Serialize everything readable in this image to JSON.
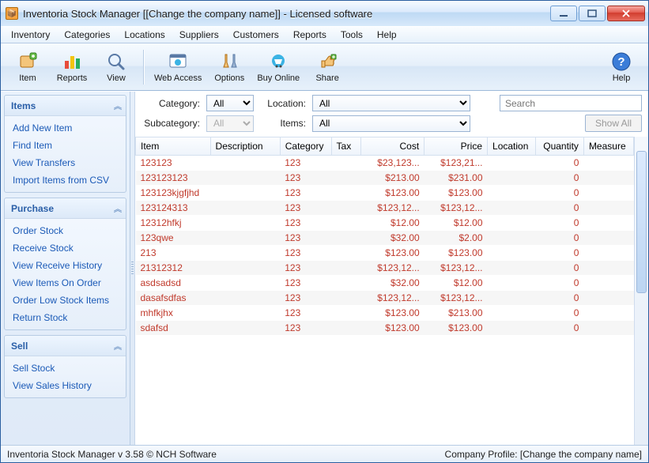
{
  "window": {
    "title": "Inventoria Stock Manager [[Change the company name]] - Licensed software"
  },
  "menu": [
    "Inventory",
    "Categories",
    "Locations",
    "Suppliers",
    "Customers",
    "Reports",
    "Tools",
    "Help"
  ],
  "toolbar": {
    "item": "Item",
    "reports": "Reports",
    "view": "View",
    "web_access": "Web Access",
    "options": "Options",
    "buy_online": "Buy Online",
    "share": "Share",
    "help": "Help"
  },
  "sidebar": {
    "groups": [
      {
        "title": "Items",
        "links": [
          "Add New Item",
          "Find Item",
          "View Transfers",
          "Import Items from CSV"
        ]
      },
      {
        "title": "Purchase",
        "links": [
          "Order Stock",
          "Receive Stock",
          "View Receive History",
          "View Items On Order",
          "Order Low Stock Items",
          "Return Stock"
        ]
      },
      {
        "title": "Sell",
        "links": [
          "Sell Stock",
          "View Sales History"
        ]
      }
    ]
  },
  "filters": {
    "category_label": "Category:",
    "category_value": "All",
    "location_label": "Location:",
    "location_value": "All",
    "subcategory_label": "Subcategory:",
    "subcategory_value": "All",
    "items_label": "Items:",
    "items_value": "All",
    "search_placeholder": "Search",
    "show_all": "Show All"
  },
  "columns": [
    "Item",
    "Description",
    "Category",
    "Tax",
    "Cost",
    "Price",
    "Location",
    "Quantity",
    "Measure"
  ],
  "rows": [
    {
      "item": "123123",
      "category": "123",
      "cost": "$23,123...",
      "price": "$123,21...",
      "qty": "0"
    },
    {
      "item": "123123123",
      "category": "123",
      "cost": "$213.00",
      "price": "$231.00",
      "qty": "0"
    },
    {
      "item": "123123kjgfjhd",
      "category": "123",
      "cost": "$123.00",
      "price": "$123.00",
      "qty": "0"
    },
    {
      "item": "123124313",
      "category": "123",
      "cost": "$123,12...",
      "price": "$123,12...",
      "qty": "0"
    },
    {
      "item": "12312hfkj",
      "category": "123",
      "cost": "$12.00",
      "price": "$12.00",
      "qty": "0"
    },
    {
      "item": "123qwe",
      "category": "123",
      "cost": "$32.00",
      "price": "$2.00",
      "qty": "0"
    },
    {
      "item": "213",
      "category": "123",
      "cost": "$123.00",
      "price": "$123.00",
      "qty": "0"
    },
    {
      "item": "21312312",
      "category": "123",
      "cost": "$123,12...",
      "price": "$123,12...",
      "qty": "0"
    },
    {
      "item": "asdsadsd",
      "category": "123",
      "cost": "$32.00",
      "price": "$12.00",
      "qty": "0"
    },
    {
      "item": "dasafsdfas",
      "category": "123",
      "cost": "$123,12...",
      "price": "$123,12...",
      "qty": "0"
    },
    {
      "item": "mhfkjhx",
      "category": "123",
      "cost": "$123.00",
      "price": "$213.00",
      "qty": "0"
    },
    {
      "item": "sdafsd",
      "category": "123",
      "cost": "$123.00",
      "price": "$123.00",
      "qty": "0"
    }
  ],
  "status": {
    "left": "Inventoria Stock Manager v 3.58 © NCH Software",
    "right": "Company Profile: [Change the company name]"
  }
}
